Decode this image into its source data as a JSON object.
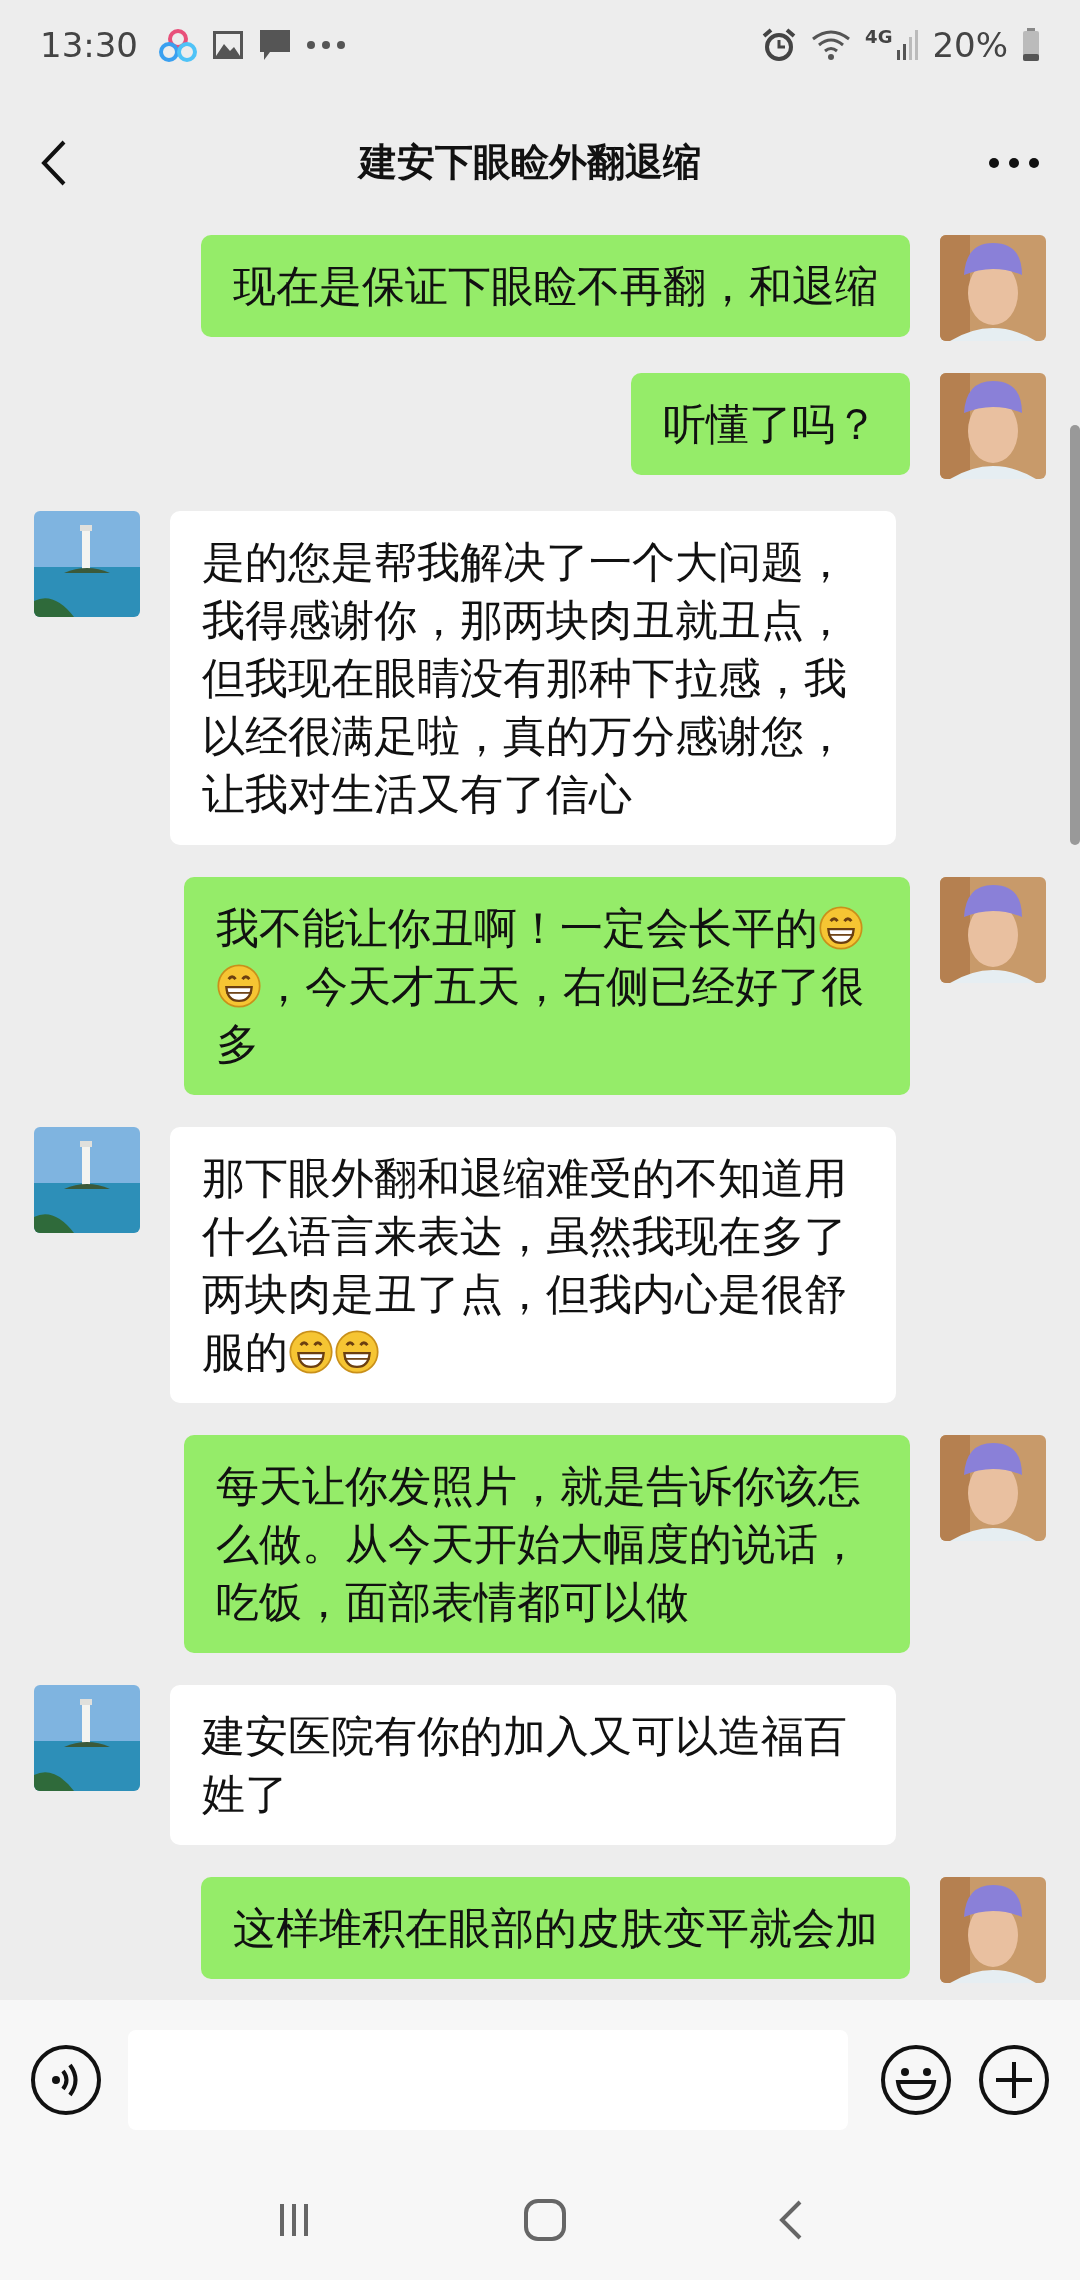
{
  "status_bar": {
    "time": "13:30",
    "network": "4G",
    "battery": "20%"
  },
  "header": {
    "title": "建安下眼睑外翻退缩"
  },
  "messages": [
    {
      "kind": "sent",
      "parts": [
        {
          "kind": "text",
          "text": "现在是保证下眼睑不再翻，和退缩"
        }
      ]
    },
    {
      "kind": "sent",
      "parts": [
        {
          "kind": "text",
          "text": "听懂了吗？"
        }
      ]
    },
    {
      "kind": "received",
      "parts": [
        {
          "kind": "text",
          "text": "是的您是帮我解决了一个大问题，我得感谢你，那两块肉丑就丑点，但我现在眼睛没有那种下拉感，我以经很满足啦，真的万分感谢您，让我对生活又有了信心"
        }
      ]
    },
    {
      "kind": "sent",
      "parts": [
        {
          "kind": "text",
          "text": "我不能让你丑啊！一定会长平的"
        },
        {
          "kind": "emoji"
        },
        {
          "kind": "emoji"
        },
        {
          "kind": "text",
          "text": "，今天才五天，右侧已经好了很"
        },
        {
          "kind": "text",
          "text": "多"
        }
      ]
    },
    {
      "kind": "received",
      "parts": [
        {
          "kind": "text",
          "text": "那下眼外翻和退缩难受的不知道用什么语言来表达，虽然我现在多了两块肉是丑了点，但我内心是很舒"
        },
        {
          "kind": "text",
          "text": "服的"
        },
        {
          "kind": "emoji"
        },
        {
          "kind": "emoji"
        }
      ]
    },
    {
      "kind": "sent",
      "parts": [
        {
          "kind": "text",
          "text": "每天让你发照片，就是告诉你该怎么做。从今天开始大幅度的说话，吃饭，面部表情都可以做"
        }
      ]
    },
    {
      "kind": "received",
      "parts": [
        {
          "kind": "text",
          "text": "建安医院有你的加入又可以造福百姓了"
        }
      ]
    },
    {
      "kind": "sent",
      "parts": [
        {
          "kind": "text",
          "text": "这样堆积在眼部的皮肤变平就会加"
        }
      ]
    }
  ]
}
